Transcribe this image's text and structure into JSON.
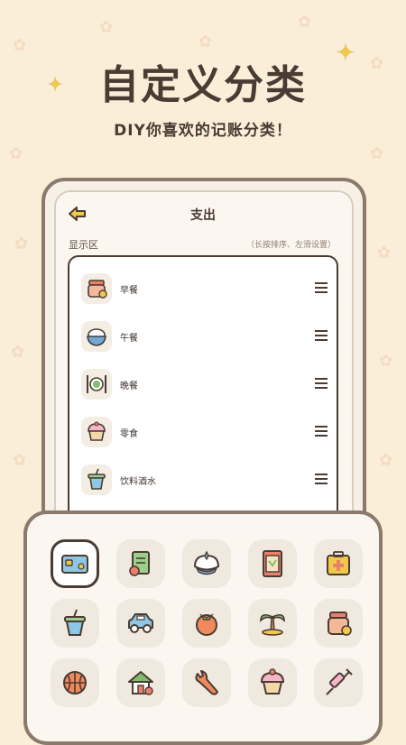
{
  "promo": {
    "headline": "自定义分类",
    "subheadline": "DIY你喜欢的记账分类！"
  },
  "screen": {
    "title": "支出",
    "section_label": "显示区",
    "section_hint": "（长按排序、左滑设置）"
  },
  "categories": [
    {
      "label": "早餐",
      "icon": "breakfast-jar-icon"
    },
    {
      "label": "午餐",
      "icon": "rice-bowl-icon"
    },
    {
      "label": "晚餐",
      "icon": "plate-cutlery-icon"
    },
    {
      "label": "零食",
      "icon": "cupcake-icon"
    },
    {
      "label": "饮料酒水",
      "icon": "drink-cup-icon"
    }
  ],
  "icon_picker": [
    "card-icon",
    "receipt-icon",
    "dumpling-icon",
    "notebook-icon",
    "medical-kit-icon",
    "drink-cup-icon",
    "car-icon",
    "tomato-icon",
    "palm-island-icon",
    "jar-icon",
    "basketball-icon",
    "house-icon",
    "wrench-icon",
    "cupcake-icon",
    "syringe-icon"
  ],
  "colors": {
    "background": "#fbeed8",
    "outline": "#4a3b33",
    "accent_yellow": "#f2c84b",
    "tile": "#efe9e0"
  }
}
